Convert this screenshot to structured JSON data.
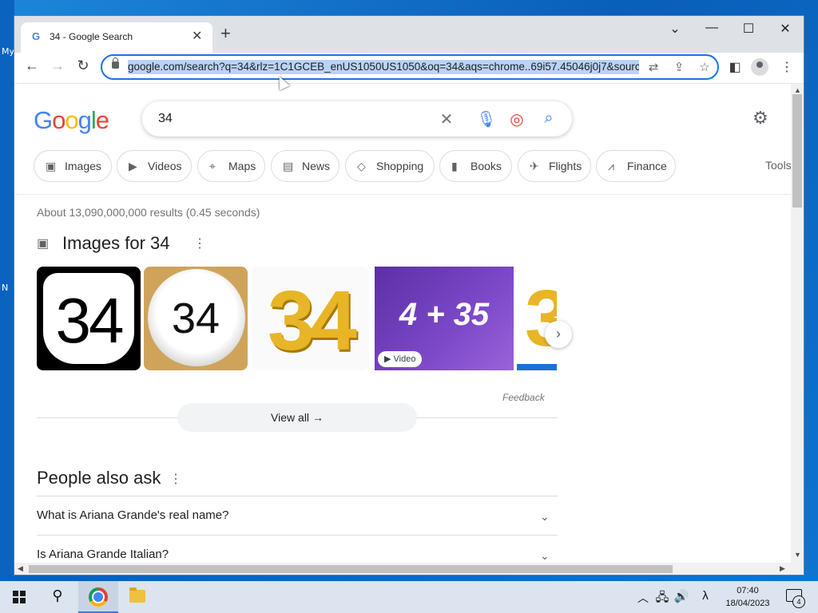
{
  "desktop": {
    "labels": [
      "My",
      "N"
    ]
  },
  "browser": {
    "tab_title": "34 - Google Search",
    "tab_favicon": "G",
    "url": "google.com/search?q=34&rlz=1C1GCEB_enUS1050US1050&oq=34&aqs=chrome..69i57.45046j0j7&sourceid=chrome&ie=UTF-8",
    "window_controls": [
      "chevron-down-icon",
      "minimize-icon",
      "maximize-icon",
      "close-icon"
    ]
  },
  "google": {
    "logo": [
      "G",
      "o",
      "o",
      "g",
      "l",
      "e"
    ],
    "logo_colors": [
      "#4285f4",
      "#ea4335",
      "#fbbc05",
      "#4285f4",
      "#34a853",
      "#ea4335"
    ],
    "query": "34",
    "chips": [
      {
        "label": "Images",
        "icon": "image-icon"
      },
      {
        "label": "Videos",
        "icon": "play-icon"
      },
      {
        "label": "Maps",
        "icon": "pin-icon"
      },
      {
        "label": "News",
        "icon": "news-icon"
      },
      {
        "label": "Shopping",
        "icon": "tag-icon"
      },
      {
        "label": "Books",
        "icon": "book-icon"
      },
      {
        "label": "Flights",
        "icon": "plane-icon"
      },
      {
        "label": "Finance",
        "icon": "chart-icon"
      }
    ],
    "tools_label": "Tools",
    "results_count": "About 13,090,000,000 results (0.45 seconds)",
    "images_heading": "Images for 34",
    "thumbnails": [
      "34",
      "34",
      "34",
      "4 + 35",
      "3"
    ],
    "video_badge": "Video",
    "feedback": "Feedback",
    "view_all": "View all",
    "paa_title": "People also ask",
    "paa_questions": [
      "What is Ariana Grande's real name?",
      "Is Ariana Grande Italian?"
    ]
  },
  "taskbar": {
    "time": "07:40",
    "date": "18/04/2023",
    "notification_count": "4"
  }
}
